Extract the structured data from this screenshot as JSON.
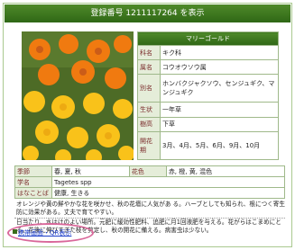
{
  "header": {
    "title": "登録番号 1211117264 を表示"
  },
  "plant": {
    "name_header": "マリーゴールド",
    "rows": [
      {
        "label": "科名",
        "value": "キク科"
      },
      {
        "label": "属名",
        "value": "コウオウソウ属"
      },
      {
        "label": "別名",
        "value": "ホンバクジャクソウ、センジュギク、マンジュギク"
      },
      {
        "label": "生状",
        "value": "一年草"
      },
      {
        "label": "樹高",
        "value": "下草"
      },
      {
        "label": "開花期",
        "value": "3月、4月、5月、6月、9月、10月"
      }
    ]
  },
  "attributes": {
    "season_label": "季節",
    "season_value": "春, 夏, 秋",
    "color_label": "花色",
    "color_value": "赤, 橙, 黄, 混色",
    "sci_label": "学名",
    "sci_value": "Tagetes spp",
    "lang_label": "はなことば",
    "lang_value": "健康, 生きる"
  },
  "description": {
    "p1": "オレンジや黄の鮮やかな花を咲かせ、秋の花壇に人気があ る。ハーブとしても知られ、根につく寄生防に効果がある。丈夫で育てやすい。",
    "p2": "日当たり、水はけのよい場所。元肥に緩効性肥料、追肥に月1回液肥を与える。花がらはこまめにとる。花後に伸びすぎた枝を剪定し、秋の開花に備える。病害虫は少ない。"
  },
  "footer": {
    "link_label": "携帯画面・QR表示"
  },
  "colors": {
    "accent": "#3a6d1b",
    "label_bg": "#e5edd9",
    "circle": "#d9689a"
  }
}
